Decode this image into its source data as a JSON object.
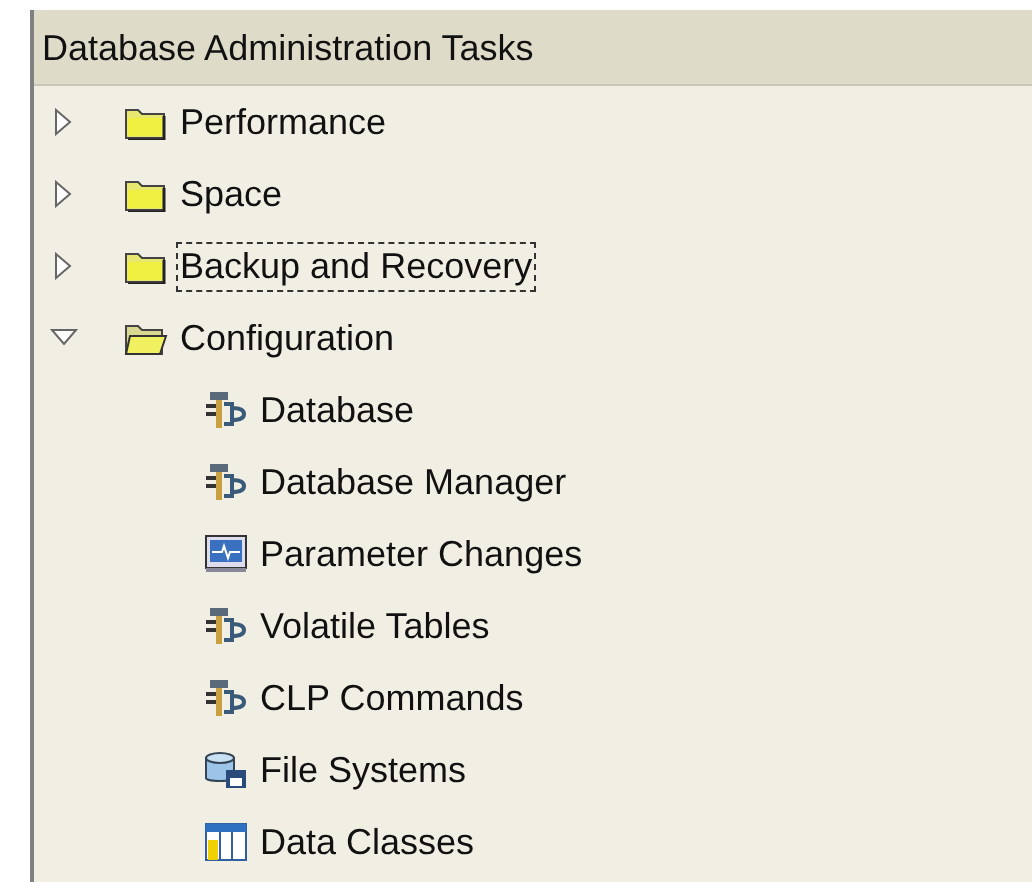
{
  "panel": {
    "title": "Database Administration Tasks"
  },
  "tree": [
    {
      "label": "Performance",
      "kind": "folder",
      "expanded": false,
      "focused": false
    },
    {
      "label": "Space",
      "kind": "folder",
      "expanded": false,
      "focused": false
    },
    {
      "label": "Backup and Recovery",
      "kind": "folder",
      "expanded": false,
      "focused": true
    },
    {
      "label": "Configuration",
      "kind": "folder",
      "expanded": true,
      "focused": false,
      "children": [
        {
          "label": "Database",
          "kind": "tool",
          "focused": false
        },
        {
          "label": "Database Manager",
          "kind": "tool",
          "focused": false
        },
        {
          "label": "Parameter Changes",
          "kind": "monitor",
          "focused": false
        },
        {
          "label": "Volatile Tables",
          "kind": "tool",
          "focused": false
        },
        {
          "label": "CLP Commands",
          "kind": "tool",
          "focused": false
        },
        {
          "label": "File Systems",
          "kind": "storage",
          "focused": false
        },
        {
          "label": "Data Classes",
          "kind": "table",
          "focused": false
        }
      ]
    }
  ]
}
